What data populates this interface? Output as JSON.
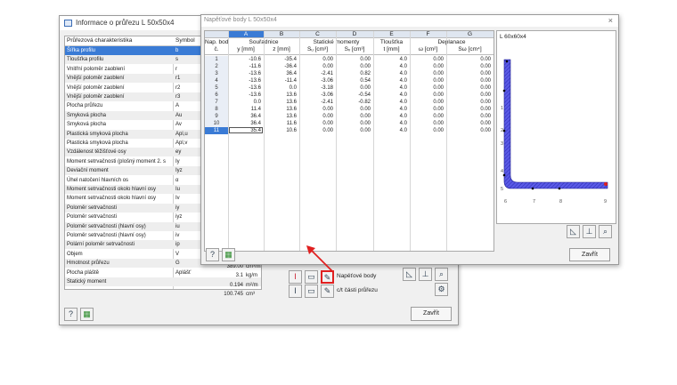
{
  "back_dialog": {
    "title": "Informace o průřezu L 50x50x4",
    "col_header_name": "Průřezová charakteristika",
    "col_header_symbol": "Symbol",
    "rows": [
      {
        "name": "Šířka profilu",
        "symbol": "b"
      },
      {
        "name": "Tloušťka profilu",
        "symbol": "s"
      },
      {
        "name": "Vnitřní poloměr zaoblení",
        "symbol": "r"
      },
      {
        "name": "Vnější poloměr zaoblení",
        "symbol": "r1"
      },
      {
        "name": "Vnější poloměr zaoblení",
        "symbol": "r2"
      },
      {
        "name": "Vnější poloměr zaoblení",
        "symbol": "r3"
      },
      {
        "name": "Plocha průřezu",
        "symbol": "A"
      },
      {
        "name": "Smyková plocha",
        "symbol": "Au"
      },
      {
        "name": "Smyková plocha",
        "symbol": "Av"
      },
      {
        "name": "Plastická smyková plocha",
        "symbol": "Apl,u"
      },
      {
        "name": "Plastická smyková plocha",
        "symbol": "Apl,v"
      },
      {
        "name": "Vzdálenost těžišťové osy",
        "symbol": "ey"
      },
      {
        "name": "Moment setrvačnosti (plošný moment 2. s",
        "symbol": "Iy"
      },
      {
        "name": "Deviační moment",
        "symbol": "Iyz"
      },
      {
        "name": "Úhel natočení hlavních os",
        "symbol": "α"
      },
      {
        "name": "Moment setrvačnosti okolo hlavní osy",
        "symbol": "Iu"
      },
      {
        "name": "Moment setrvačnosti okolo hlavní osy",
        "symbol": "Iv"
      },
      {
        "name": "Poloměr setrvačnosti",
        "symbol": "iy"
      },
      {
        "name": "Poloměr setrvačnosti",
        "symbol": "iyz"
      },
      {
        "name": "Poloměr setrvačnosti (hlavní osy)",
        "symbol": "iu"
      },
      {
        "name": "Poloměr setrvačnosti (hlavní osy)",
        "symbol": "iv"
      },
      {
        "name": "Polární poloměr setrvačnosti",
        "symbol": "ip"
      },
      {
        "name": "Objem",
        "symbol": "V"
      },
      {
        "name": "Hmotnost průřezu",
        "symbol": "G"
      },
      {
        "name": "Plocha pláště",
        "symbol": "Aplášť"
      },
      {
        "name": "Statický moment",
        "symbol": ""
      }
    ],
    "values": [
      {
        "value": "389.00",
        "unit": "cm³/m"
      },
      {
        "value": "3.1",
        "unit": "kg/m"
      },
      {
        "value": "0.194",
        "unit": "m²/m"
      },
      {
        "value": "100.745",
        "unit": "cm³"
      }
    ],
    "stress_points_label": "Napěťové body",
    "parts_label": "c/t části průřezu",
    "close_button": "Zavřít"
  },
  "front_dialog": {
    "title": "Napěťové body L 50x50x4",
    "close_symbol": "×",
    "col_letters": [
      "A",
      "B",
      "C",
      "D",
      "E",
      "F",
      "G"
    ],
    "group_headers": {
      "point": "Nap. bod",
      "point_sub": "č.",
      "coords": "Souřadnice",
      "static": "Statické momenty",
      "thickness": "Tloušťka",
      "warping": "Deplanace"
    },
    "sub_headers": [
      "y [mm]",
      "z [mm]",
      "Sᵤ [cm³]",
      "Sᵥ [cm³]",
      "t [mm]",
      "ω [cm²]",
      "Sω [cm⁴]"
    ],
    "rows": [
      {
        "no": "1",
        "y": "-10.6",
        "z": "-35.4",
        "su": "0.00",
        "sv": "0.00",
        "t": "4.0",
        "w": "0.00",
        "sw": "0.00"
      },
      {
        "no": "2",
        "y": "-11.6",
        "z": "-36.4",
        "su": "0.00",
        "sv": "0.00",
        "t": "4.0",
        "w": "0.00",
        "sw": "0.00"
      },
      {
        "no": "3",
        "y": "-13.6",
        "z": "36.4",
        "su": "-2.41",
        "sv": "0.82",
        "t": "4.0",
        "w": "0.00",
        "sw": "0.00"
      },
      {
        "no": "4",
        "y": "-13.6",
        "z": "-11.4",
        "su": "-3.06",
        "sv": "0.54",
        "t": "4.0",
        "w": "0.00",
        "sw": "0.00"
      },
      {
        "no": "5",
        "y": "-13.6",
        "z": "0.0",
        "su": "-3.18",
        "sv": "0.00",
        "t": "4.0",
        "w": "0.00",
        "sw": "0.00"
      },
      {
        "no": "6",
        "y": "-13.6",
        "z": "13.6",
        "su": "-3.06",
        "sv": "-0.54",
        "t": "4.0",
        "w": "0.00",
        "sw": "0.00"
      },
      {
        "no": "7",
        "y": "0.0",
        "z": "13.6",
        "su": "-2.41",
        "sv": "-0.82",
        "t": "4.0",
        "w": "0.00",
        "sw": "0.00"
      },
      {
        "no": "8",
        "y": "11.4",
        "z": "13.6",
        "su": "0.00",
        "sv": "0.00",
        "t": "4.0",
        "w": "0.00",
        "sw": "0.00"
      },
      {
        "no": "9",
        "y": "36.4",
        "z": "13.6",
        "su": "0.00",
        "sv": "0.00",
        "t": "4.0",
        "w": "0.00",
        "sw": "0.00"
      },
      {
        "no": "10",
        "y": "36.4",
        "z": "11.6",
        "su": "0.00",
        "sv": "0.00",
        "t": "4.0",
        "w": "0.00",
        "sw": "0.00"
      },
      {
        "no": "11",
        "y": "35.4",
        "z": "10.6",
        "su": "0.00",
        "sv": "0.00",
        "t": "4.0",
        "w": "0.00",
        "sw": "0.00"
      }
    ],
    "preview_label": "L 60x60x4",
    "point_labels": [
      "1",
      "2",
      "3",
      "4",
      "5",
      "6",
      "7",
      "8",
      "9"
    ],
    "close_button": "Zavřít"
  },
  "colors": {
    "accent": "#3a7bd5",
    "section_fill": "#4a4adc",
    "annotation": "#e02020"
  }
}
